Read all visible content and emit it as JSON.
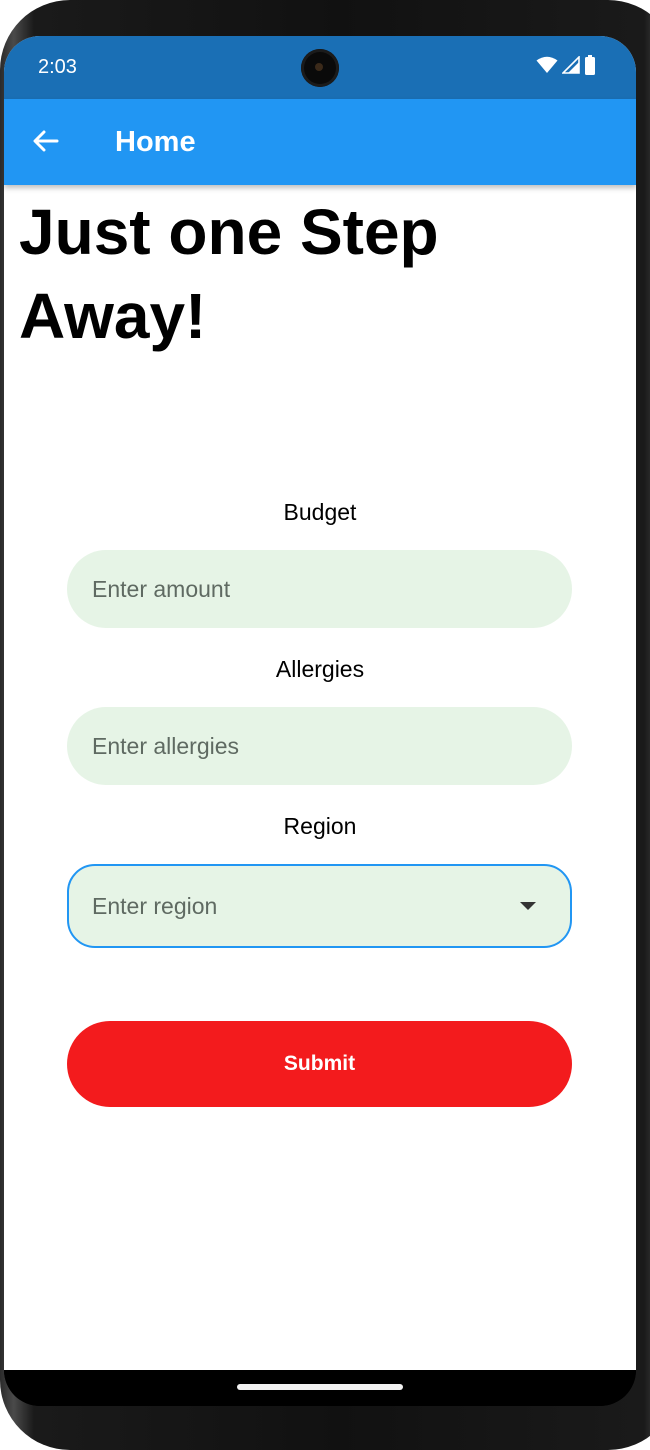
{
  "status_bar": {
    "time": "2:03"
  },
  "app_bar": {
    "title": "Home",
    "back_icon": "arrow-left-icon"
  },
  "headline": "Just one Step Away!",
  "form": {
    "budget": {
      "label": "Budget",
      "placeholder": "Enter amount"
    },
    "allergies": {
      "label": "Allergies",
      "placeholder": "Enter allergies"
    },
    "region": {
      "label": "Region",
      "placeholder": "Enter region"
    },
    "submit_label": "Submit"
  },
  "colors": {
    "status_bar": "#1a6fb5",
    "app_bar": "#2196f3",
    "input_fill": "#e6f4e6",
    "focus_border": "#2196f3",
    "submit": "#f31b1d"
  }
}
